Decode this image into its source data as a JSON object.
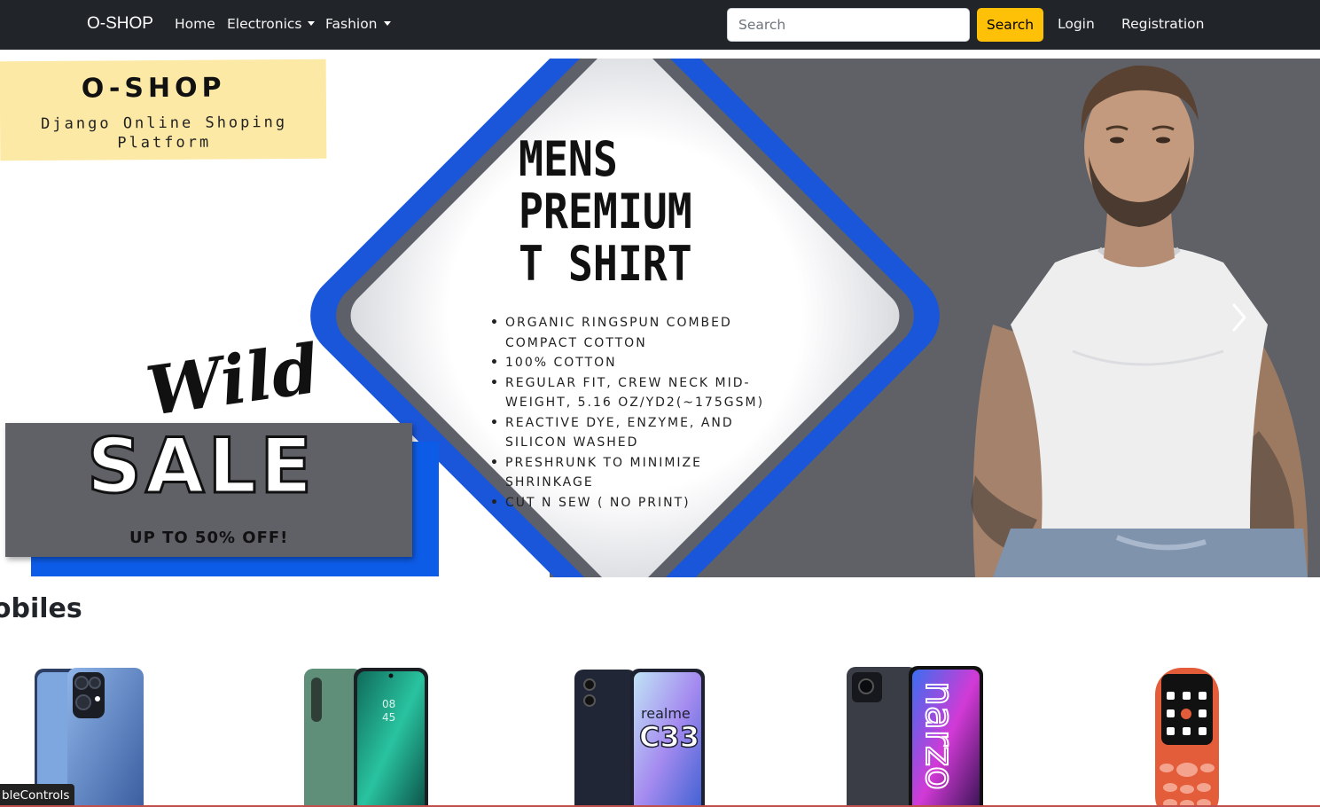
{
  "nav": {
    "brand": "O-SHOP",
    "home": "Home",
    "electronics": "Electronics",
    "fashion": "Fashion",
    "search_placeholder": "Search",
    "search_button": "Search",
    "login": "Login",
    "registration": "Registration"
  },
  "banner": {
    "logo_title": "O-SHOP",
    "logo_sub": "Django Online Shoping Platform",
    "headline_1": "MENS",
    "headline_2": "PREMIUM",
    "headline_3": "T SHIRT",
    "features": [
      "ORGANIC RINGSPUN COMBED COMPACT COTTON",
      "100% COTTON",
      "REGULAR FIT, CREW NECK MID-WEIGHT, 5.16 OZ/YD2(~175GSM)",
      "REACTIVE DYE, ENZYME, AND SILICON WASHED",
      "PRESHRUNK TO MINIMIZE SHRINKAGE",
      "CUT N SEW ( NO PRINT)"
    ],
    "wild": "Wild",
    "sale": "SALE",
    "sale_sub": "UP TO 50% OFF!"
  },
  "section": {
    "title": "Mobiles"
  },
  "products": {
    "p3_brand": "realme",
    "p3_model": "C33",
    "p4_brand": "narzo"
  },
  "status": {
    "tooltip": "bleControls"
  },
  "colors": {
    "navbar": "#212529",
    "search_button": "#ffc107",
    "banner_blue": "#1a56d9",
    "banner_grey": "#5f6167"
  },
  "icons": {
    "carousel_next": "chevron-right-icon",
    "dropdown": "caret-down-icon"
  }
}
